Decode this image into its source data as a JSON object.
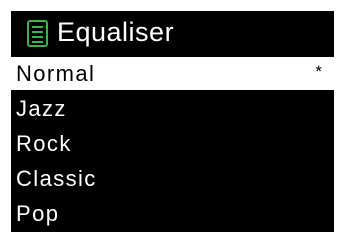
{
  "header": {
    "title": "Equaliser",
    "icon": "list-menu-icon",
    "icon_color": "#3ab54a"
  },
  "menu": {
    "items": [
      {
        "label": "Normal",
        "selected": true,
        "marker": "*"
      },
      {
        "label": "Jazz",
        "selected": false
      },
      {
        "label": "Rock",
        "selected": false
      },
      {
        "label": "Classic",
        "selected": false
      },
      {
        "label": "Pop",
        "selected": false
      }
    ]
  },
  "colors": {
    "background": "#000000",
    "text": "#ffffff",
    "highlight": "#ffffff",
    "highlight_text": "#000000"
  }
}
